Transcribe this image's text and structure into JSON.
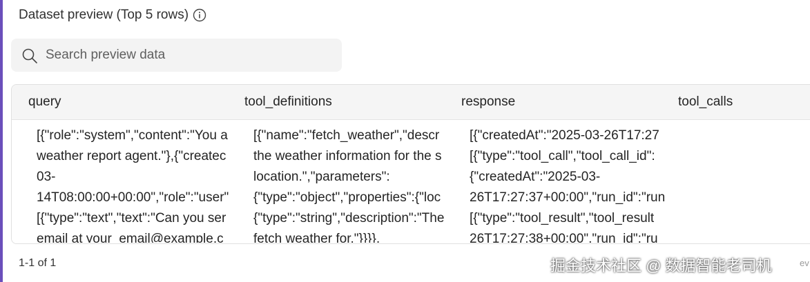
{
  "header": {
    "title": "Dataset preview (Top 5 rows)",
    "info_icon": "info-icon"
  },
  "search": {
    "placeholder": "Search preview data",
    "value": "",
    "icon": "search-icon"
  },
  "table": {
    "columns": [
      "query",
      "tool_definitions",
      "response",
      "tool_calls"
    ],
    "row": {
      "query": "[{\"role\":\"system\",\"content\":\"You a\nweather report agent.\"},{\"createc\n03-\n14T08:00:00+00:00\",\"role\":\"user\"\n[{\"type\":\"text\",\"text\":\"Can you ser\nemail at your_email@example.c",
      "tool_definitions": "[{\"name\":\"fetch_weather\",\"descr\nthe weather information for the s\nlocation.\",\"parameters\":\n{\"type\":\"object\",\"properties\":{\"loc\n{\"type\":\"string\",\"description\":\"The\nfetch weather for.\"}}}},",
      "response": "[{\"createdAt\":\"2025-03-26T17:27\n[{\"type\":\"tool_call\",\"tool_call_id\":\n{\"createdAt\":\"2025-03-\n26T17:27:37+00:00\",\"run_id\":\"run\n[{\"type\":\"tool_result\",\"tool_result\n26T17:27:38+00:00\",\"run_id\":\"ru",
      "tool_calls": ""
    }
  },
  "footer": {
    "pagination": "1-1 of 1"
  },
  "watermark": {
    "text": "掘金技术社区 @ 数据智能老司机",
    "tail": "ev"
  },
  "colors": {
    "accent": "#6b4fbb",
    "header_bg": "#f5f5f5",
    "search_bg": "#f3f3f3"
  }
}
